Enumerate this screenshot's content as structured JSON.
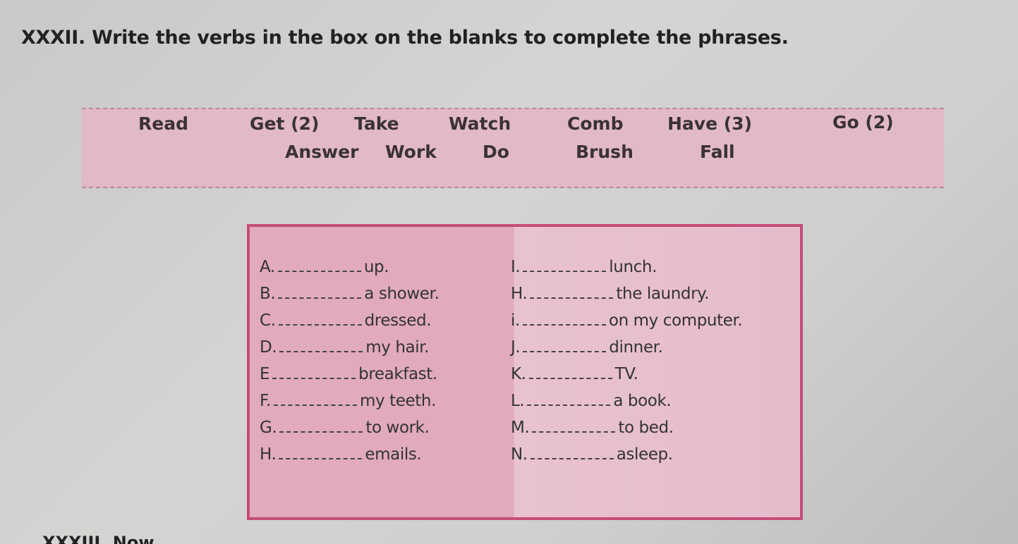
{
  "exercise": {
    "title": "XXXII. Write the verbs in the box on the blanks to complete the phrases.",
    "word_box": [
      "Read",
      "Get (2)",
      "Take",
      "Watch",
      "Comb",
      "Have (3)",
      "Go (2)",
      "Answer",
      "Work",
      "Do",
      "Brush",
      "Fall"
    ],
    "left_items": [
      {
        "label": "A.",
        "text": "up."
      },
      {
        "label": "B.",
        "text": "a shower."
      },
      {
        "label": "C.",
        "text": "dressed."
      },
      {
        "label": "D.",
        "text": "my hair."
      },
      {
        "label": "E",
        "text": "breakfast."
      },
      {
        "label": "F.",
        "text": "my teeth."
      },
      {
        "label": "G.",
        "text": "to work."
      },
      {
        "label": "H.",
        "text": "emails."
      }
    ],
    "right_items": [
      {
        "label": "I.",
        "text": "lunch."
      },
      {
        "label": "H.",
        "text": "the laundry."
      },
      {
        "label": "i.",
        "text": "on my computer."
      },
      {
        "label": "J.",
        "text": "dinner."
      },
      {
        "label": "K.",
        "text": "TV."
      },
      {
        "label": "L.",
        "text": "a book."
      },
      {
        "label": "M.",
        "text": "to bed."
      },
      {
        "label": "N.",
        "text": "asleep."
      }
    ],
    "colors": {
      "box_fill": "#e2b9c6",
      "border": "#c64c79"
    }
  },
  "next_exercise": {
    "title": "XXXIII. Now"
  }
}
